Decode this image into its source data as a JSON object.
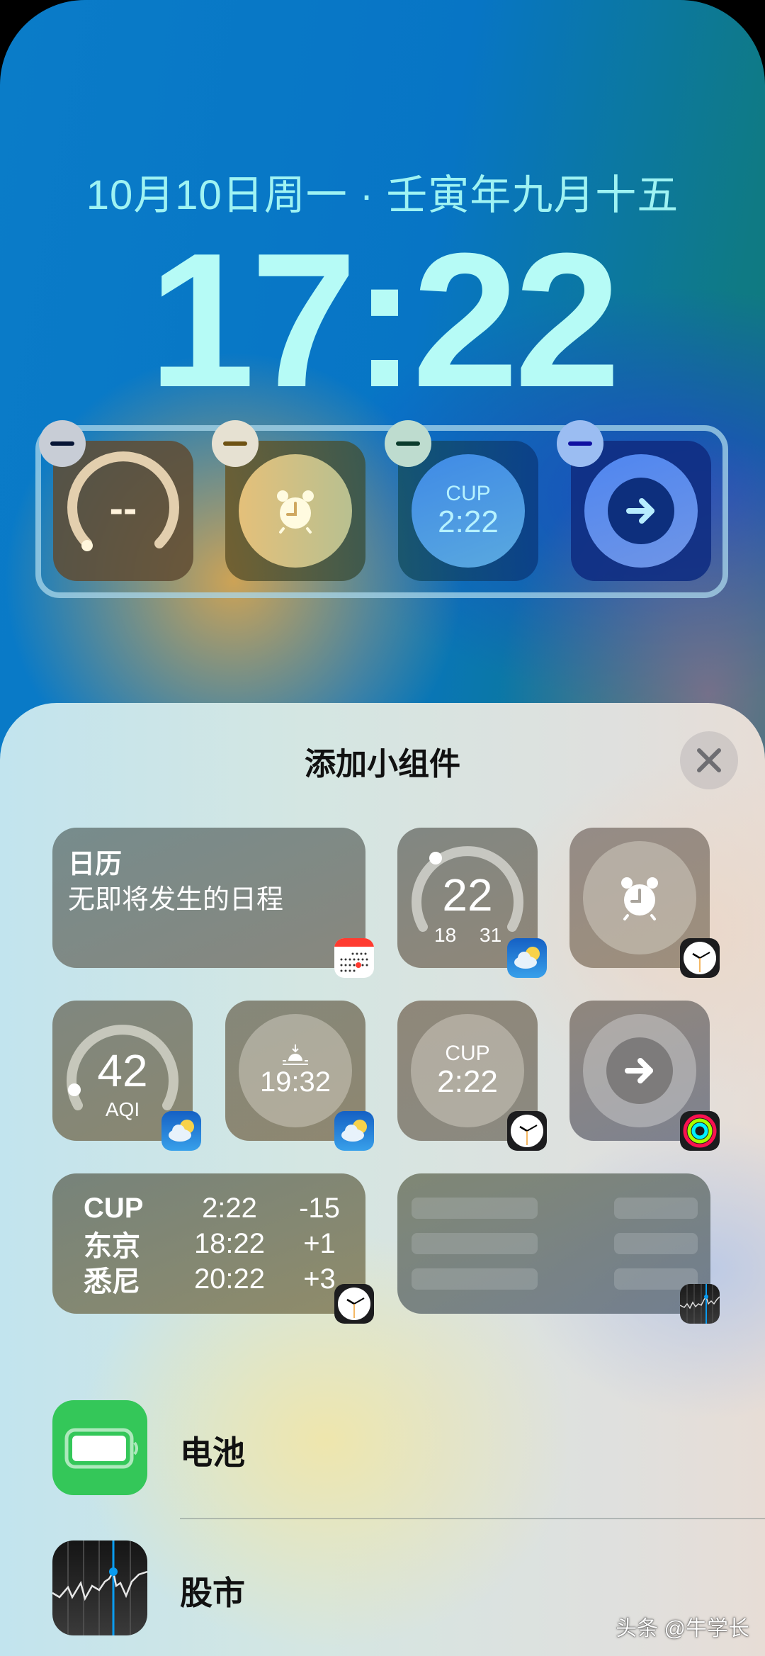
{
  "lockscreen": {
    "date_line": "10月10日周一 · 壬寅年九月十五",
    "time": "17:22",
    "widgets": [
      {
        "name": "gauge",
        "value": "--"
      },
      {
        "name": "alarm",
        "icon": "alarm-clock-icon"
      },
      {
        "name": "world-clock",
        "city": "CUP",
        "time": "2:22"
      },
      {
        "name": "activity",
        "icon": "arrow-right-icon"
      }
    ],
    "remove_icon": "minus-icon"
  },
  "sheet": {
    "title": "添加小组件",
    "close_icon": "close-icon",
    "widgets": {
      "calendar": {
        "title": "日历",
        "subtitle": "无即将发生的日程",
        "app": "calendar"
      },
      "temperature": {
        "current": "22",
        "low": "18",
        "high": "31",
        "app": "weather"
      },
      "alarm": {
        "app": "clock"
      },
      "aqi": {
        "value": "42",
        "label": "AQI",
        "app": "weather"
      },
      "sunset": {
        "time": "19:32",
        "app": "weather"
      },
      "world_clock": {
        "city": "CUP",
        "time": "2:22",
        "app": "clock"
      },
      "activity": {
        "app": "fitness"
      },
      "world_clock_list": {
        "rows": [
          {
            "city": "CUP",
            "time": "2:22",
            "offset": "-15"
          },
          {
            "city": "东京",
            "time": "18:22",
            "offset": "+1"
          },
          {
            "city": "悉尼",
            "time": "20:22",
            "offset": "+3"
          }
        ],
        "app": "clock"
      },
      "stocks_placeholder": {
        "app": "stocks"
      }
    },
    "apps": [
      {
        "label": "电池",
        "icon": "battery-icon",
        "color": "#34c759"
      },
      {
        "label": "股市",
        "icon": "stocks-icon",
        "color": "#1c1c1e"
      }
    ]
  },
  "watermark": "头条 @牛学长"
}
